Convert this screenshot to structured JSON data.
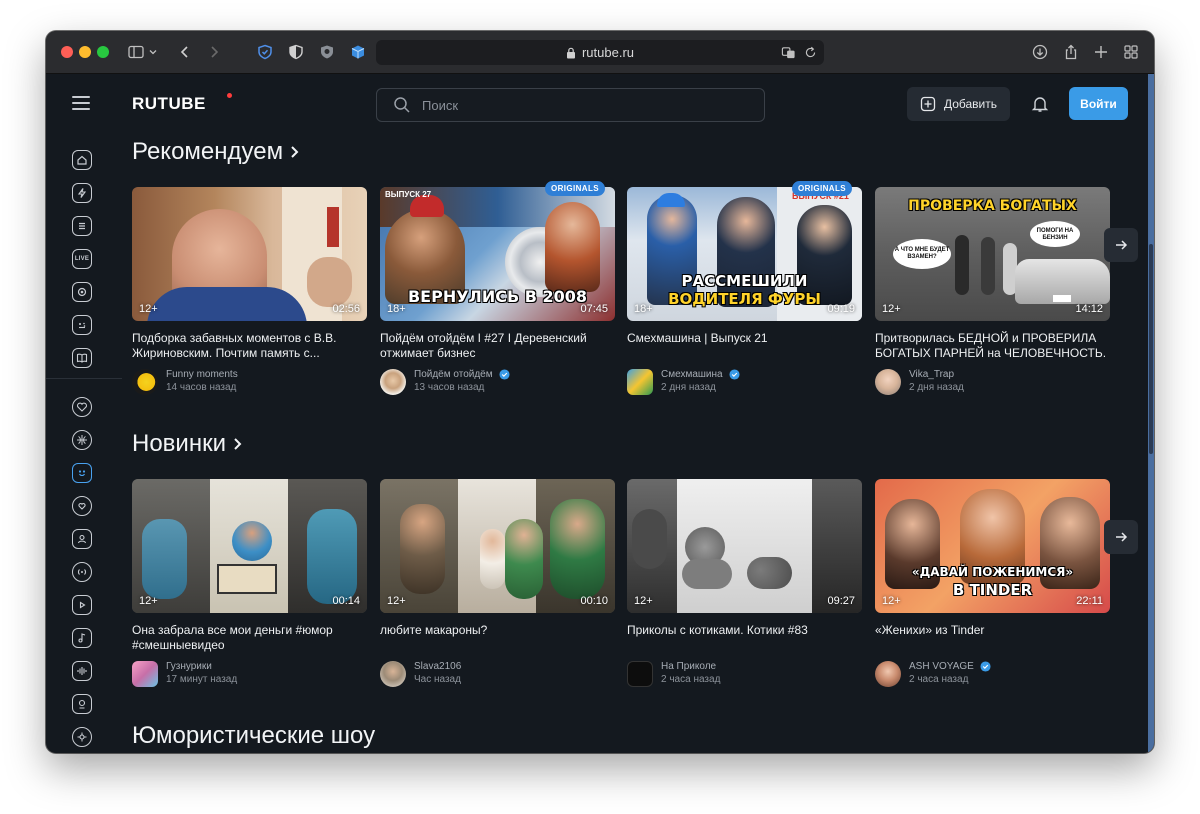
{
  "browser": {
    "url": "rutube.ru"
  },
  "header": {
    "logo": "RUTUBE",
    "search_placeholder": "Поиск",
    "add_label": "Добавить",
    "login_label": "Войти"
  },
  "sections": [
    {
      "title": "Рекомендуем",
      "videos": [
        {
          "title": "Подборка забавных моментов с В.В. Жириновским. Почтим память с...",
          "channel": "Funny moments",
          "time": "14 часов назад",
          "age": "12+",
          "duration": "02:56",
          "verified": false,
          "originals": ""
        },
        {
          "title": "Пойдём отойдём I #27 I Деревенский отжимает бизнес",
          "channel": "Пойдём отойдём",
          "time": "13 часов назад",
          "age": "18+",
          "duration": "07:45",
          "verified": true,
          "originals": "ORIGINALS",
          "overlay": "ВЕРНУЛИСЬ В 2008",
          "episode": "ВЫПУСК 27"
        },
        {
          "title": "Смехмашина | Выпуск 21",
          "channel": "Смехмашина",
          "time": "2 дня назад",
          "age": "18+",
          "duration": "09:19",
          "verified": true,
          "originals": "ORIGINALS",
          "overlay_top": "РАССМЕШИЛИ",
          "overlay_bottom": "ВОДИТЕЛЯ ФУРЫ",
          "episode": "ВЫПУСК #21"
        },
        {
          "title": "Притворилась БЕДНОЙ и ПРОВЕРИЛА БОГАТЫХ ПАРНЕЙ на ЧЕЛОВЕЧНОСТЬ.",
          "channel": "Vika_Trap",
          "time": "2 дня назад",
          "age": "12+",
          "duration": "14:12",
          "verified": false,
          "originals": "",
          "overlay": "ПРОВЕРКА БОГАТЫХ",
          "bubble1": "А ЧТО МНЕ БУДЕТ ВЗАМЕН?",
          "bubble2": "ПОМОГИ НА БЕНЗИН"
        }
      ]
    },
    {
      "title": "Новинки",
      "videos": [
        {
          "title": "Она забрала все мои деньги #юмор #смешныевидео",
          "channel": "Гузнурики",
          "time": "17 минут назад",
          "age": "12+",
          "duration": "00:14",
          "verified": false
        },
        {
          "title": "любите макароны?",
          "channel": "Slava2106",
          "time": "Час назад",
          "age": "12+",
          "duration": "00:10",
          "verified": false
        },
        {
          "title": "Приколы с котиками. Котики #83",
          "channel": "На Приколе",
          "time": "2 часа назад",
          "age": "12+",
          "duration": "09:27",
          "verified": false
        },
        {
          "title": "«Женихи» из Tinder",
          "channel": "ASH VOYAGE",
          "time": "2 часа назад",
          "age": "12+",
          "duration": "22:11",
          "verified": true,
          "overlay_top": "«ДАВАЙ ПОЖЕНИМСЯ»",
          "overlay_bottom": "В TINDER"
        }
      ]
    },
    {
      "title": "Юмористические шоу"
    }
  ],
  "sidebar": {
    "live_label": "LIVE"
  },
  "colors": {
    "background": "#14191f",
    "accent": "#3a9be7",
    "originals_badge": "#2f7fd6"
  }
}
